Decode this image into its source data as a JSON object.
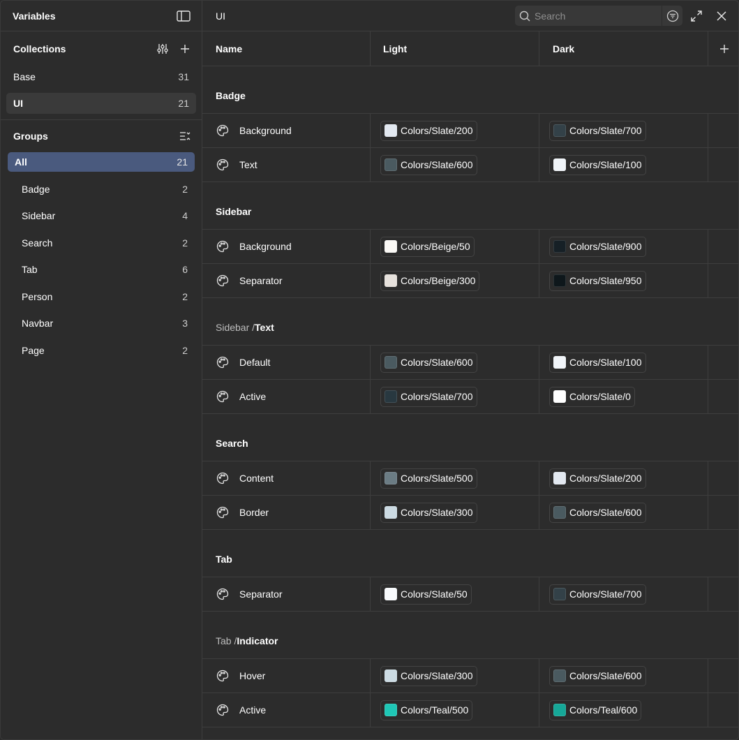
{
  "sidebar": {
    "title": "Variables",
    "collections_title": "Collections",
    "collections": [
      {
        "label": "Base",
        "count": "31",
        "selected": false
      },
      {
        "label": "UI",
        "count": "21",
        "selected": true
      }
    ],
    "groups_title": "Groups",
    "groups": [
      {
        "label": "All",
        "count": "21",
        "selected": true
      },
      {
        "label": "Badge",
        "count": "2",
        "selected": false
      },
      {
        "label": "Sidebar",
        "count": "4",
        "selected": false
      },
      {
        "label": "Search",
        "count": "2",
        "selected": false
      },
      {
        "label": "Tab",
        "count": "6",
        "selected": false
      },
      {
        "label": "Person",
        "count": "2",
        "selected": false
      },
      {
        "label": "Navbar",
        "count": "3",
        "selected": false
      },
      {
        "label": "Page",
        "count": "2",
        "selected": false
      }
    ]
  },
  "header": {
    "title": "UI",
    "search_placeholder": "Search"
  },
  "table": {
    "columns": {
      "name": "Name",
      "light": "Light",
      "dark": "Dark"
    },
    "groups": [
      {
        "parent": "",
        "name": "Badge",
        "vars": [
          {
            "name": "Background",
            "light": {
              "label": "Colors/Slate/200",
              "color": "#e2e8f0"
            },
            "dark": {
              "label": "Colors/Slate/700",
              "color": "#334148"
            }
          },
          {
            "name": "Text",
            "light": {
              "label": "Colors/Slate/600",
              "color": "#4a5a60"
            },
            "dark": {
              "label": "Colors/Slate/100",
              "color": "#f1f5f9"
            }
          }
        ]
      },
      {
        "parent": "",
        "name": "Sidebar",
        "vars": [
          {
            "name": "Background",
            "light": {
              "label": "Colors/Beige/50",
              "color": "#fbf9f6"
            },
            "dark": {
              "label": "Colors/Slate/900",
              "color": "#162026"
            }
          },
          {
            "name": "Separator",
            "light": {
              "label": "Colors/Beige/300",
              "color": "#e6e1dc"
            },
            "dark": {
              "label": "Colors/Slate/950",
              "color": "#0e171b"
            }
          }
        ]
      },
      {
        "parent": "Sidebar / ",
        "name": "Text",
        "vars": [
          {
            "name": "Default",
            "light": {
              "label": "Colors/Slate/600",
              "color": "#4a5a60"
            },
            "dark": {
              "label": "Colors/Slate/100",
              "color": "#f1f5f9"
            }
          },
          {
            "name": "Active",
            "light": {
              "label": "Colors/Slate/700",
              "color": "#283840"
            },
            "dark": {
              "label": "Colors/Slate/0",
              "color": "#ffffff"
            }
          }
        ]
      },
      {
        "parent": "",
        "name": "Search",
        "vars": [
          {
            "name": "Content",
            "light": {
              "label": "Colors/Slate/500",
              "color": "#6b7c84"
            },
            "dark": {
              "label": "Colors/Slate/200",
              "color": "#e2e8f0"
            }
          },
          {
            "name": "Border",
            "light": {
              "label": "Colors/Slate/300",
              "color": "#ccdbe3"
            },
            "dark": {
              "label": "Colors/Slate/600",
              "color": "#4a5a60"
            }
          }
        ]
      },
      {
        "parent": "",
        "name": "Tab",
        "vars": [
          {
            "name": "Separator",
            "light": {
              "label": "Colors/Slate/50",
              "color": "#f8fafc"
            },
            "dark": {
              "label": "Colors/Slate/700",
              "color": "#334148"
            }
          }
        ]
      },
      {
        "parent": "Tab / ",
        "name": "Indicator",
        "vars": [
          {
            "name": "Hover",
            "light": {
              "label": "Colors/Slate/300",
              "color": "#ccdbe3"
            },
            "dark": {
              "label": "Colors/Slate/600",
              "color": "#4a5a60"
            }
          },
          {
            "name": "Active",
            "light": {
              "label": "Colors/Teal/500",
              "color": "#1fc7b6"
            },
            "dark": {
              "label": "Colors/Teal/600",
              "color": "#16a898"
            }
          }
        ]
      }
    ]
  }
}
